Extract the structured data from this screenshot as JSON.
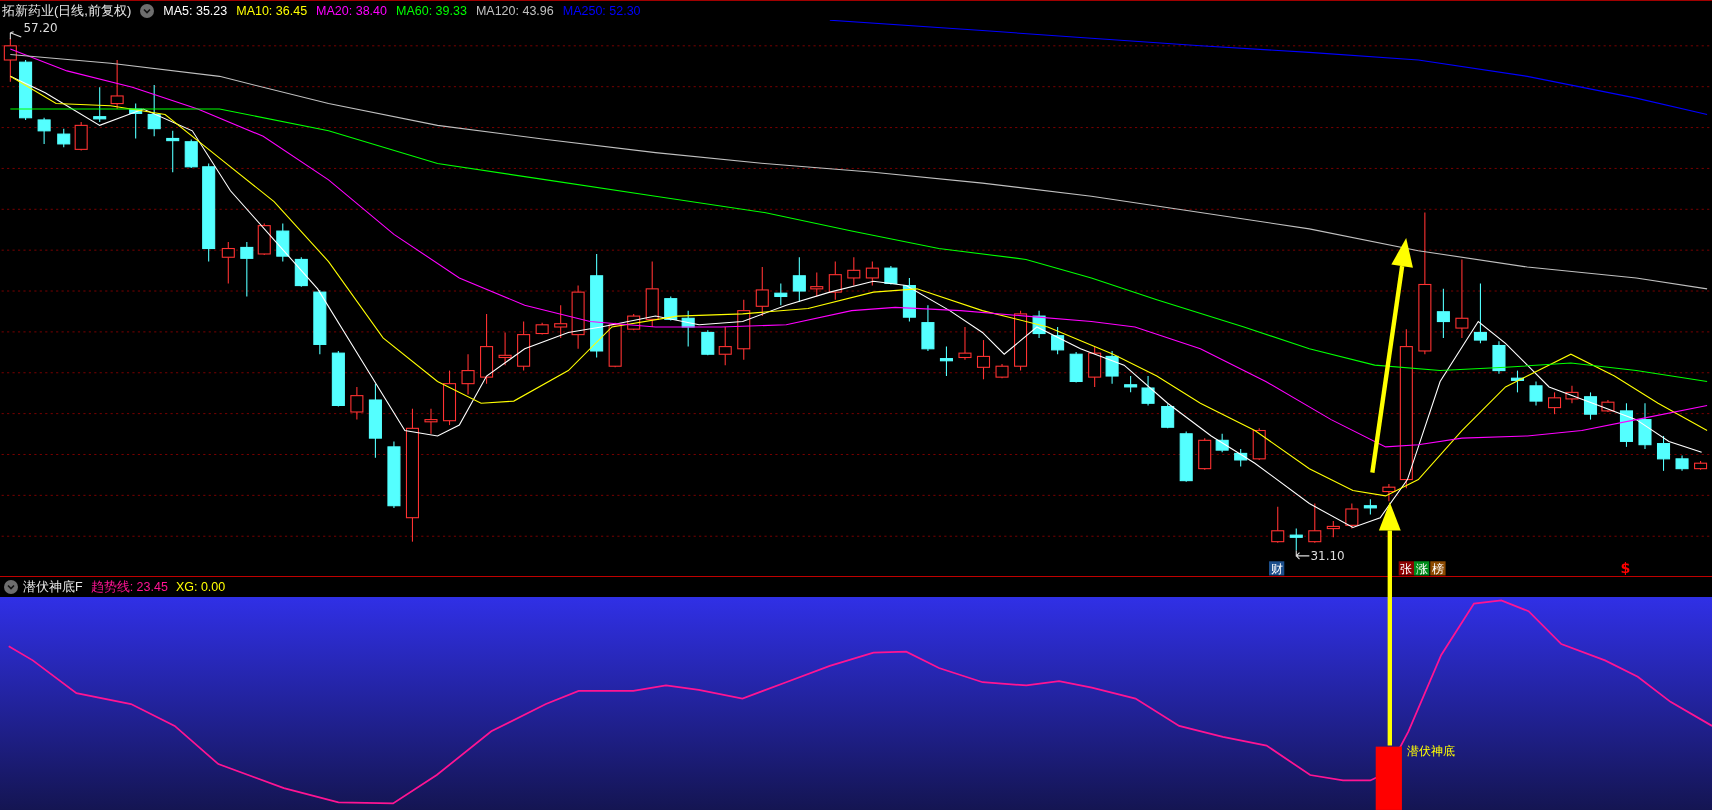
{
  "header": {
    "title": "拓新药业(日线,前复权)",
    "averages": [
      {
        "label": "MA5: 35.23",
        "color": "#ffffff"
      },
      {
        "label": "MA10: 36.45",
        "color": "#ffff00"
      },
      {
        "label": "MA20: 38.40",
        "color": "#ff00ff"
      },
      {
        "label": "MA60: 39.33",
        "color": "#00ff00"
      },
      {
        "label": "MA120: 43.96",
        "color": "#c0c0c0"
      },
      {
        "label": "MA250: 52.30",
        "color": "#0000ff"
      }
    ]
  },
  "price_chart": {
    "high_label": "57.20",
    "low_label": "31.10",
    "events": [
      {
        "text": "财",
        "color": "#1c4f8c"
      },
      {
        "text": "张",
        "color": "#8c0000"
      },
      {
        "text": "涨",
        "color": "#008c1c"
      },
      {
        "text": "榜",
        "color": "#8c4a00"
      },
      {
        "text": "$",
        "color": "#ff0000"
      }
    ]
  },
  "indicator": {
    "name": "潜伏神底F",
    "values": [
      {
        "label": "趋势线: 23.45",
        "color": "#ff1493"
      },
      {
        "label": "XG: 0.00",
        "color": "#ffff00"
      }
    ],
    "signal_label": "潜伏神底"
  }
}
